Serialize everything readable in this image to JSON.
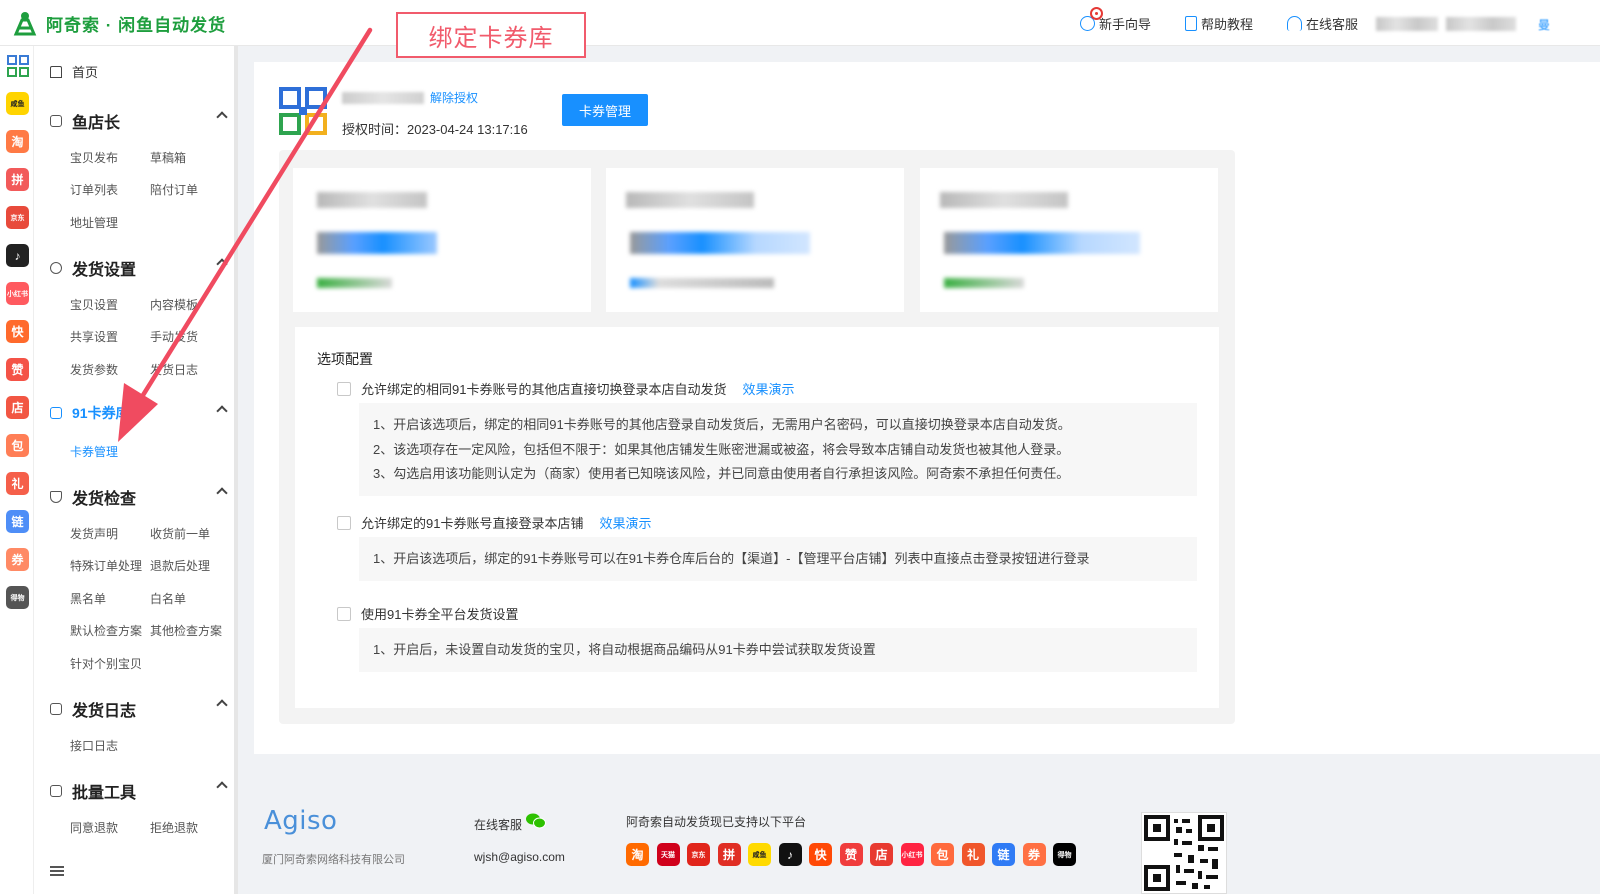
{
  "app": {
    "title": "阿奇索 · 闲鱼自动发货",
    "brand_color": "#1e9e3e",
    "accent": "#1890ff"
  },
  "header": {
    "links": [
      {
        "label": "新手向导",
        "icon": "guide-icon"
      },
      {
        "label": "帮助教程",
        "icon": "doc-icon"
      },
      {
        "label": "在线客服",
        "icon": "headset-icon"
      }
    ],
    "user_trailing": "曼"
  },
  "annotation": {
    "callout_text": "绑定卡券库",
    "color": "#f15b6c"
  },
  "iconbar": [
    {
      "name": "xianyu-app-icon",
      "label": "咸鱼",
      "color": "#ffd400"
    },
    {
      "name": "taobao-app-icon",
      "label": "淘",
      "color": "#ff7a45"
    },
    {
      "name": "pinduoduo-app-icon",
      "label": "拼",
      "color": "#f25a5a"
    },
    {
      "name": "jd-app-icon",
      "label": "京东",
      "color": "#e84a3b"
    },
    {
      "name": "douyin-app-icon",
      "label": "♪",
      "color": "#222222"
    },
    {
      "name": "xiaohongshu-app-icon",
      "label": "小红书",
      "color": "#ff5a5f"
    },
    {
      "name": "kuaishou-app-icon",
      "label": "快",
      "color": "#ff6a2c"
    },
    {
      "name": "like-app-icon",
      "label": "赞",
      "color": "#f45347"
    },
    {
      "name": "store-app-icon",
      "label": "店",
      "color": "#f25643"
    },
    {
      "name": "bag-app-icon",
      "label": "包",
      "color": "#ff7e56"
    },
    {
      "name": "gift-app-icon",
      "label": "礼",
      "color": "#f55f4a"
    },
    {
      "name": "link-app-icon",
      "label": "链",
      "color": "#4e8ef7"
    },
    {
      "name": "ticket-app-icon",
      "label": "券",
      "color": "#ff8a65"
    },
    {
      "name": "dewu-app-icon",
      "label": "得物",
      "color": "#555555"
    }
  ],
  "sidebar": {
    "home": "首页",
    "groups": [
      {
        "label": "鱼店长",
        "items": [
          "宝贝发布",
          "草稿箱",
          "订单列表",
          "陪付订单",
          "地址管理"
        ]
      },
      {
        "label": "发货设置",
        "items": [
          "宝贝设置",
          "内容模板",
          "共享设置",
          "手动发货",
          "发货参数",
          "发货日志"
        ]
      },
      {
        "label": "91卡券库",
        "items": [
          "卡券管理"
        ]
      },
      {
        "label": "发货检查",
        "items": [
          "发货声明",
          "收货前一单",
          "特殊订单处理",
          "退款后处理",
          "黑名单",
          "白名单",
          "默认检查方案",
          "其他检查方案",
          "针对个别宝贝"
        ]
      },
      {
        "label": "发货日志",
        "items": [
          "接口日志"
        ]
      },
      {
        "label": "批量工具",
        "items": [
          "同意退款",
          "拒绝退款"
        ]
      }
    ]
  },
  "main": {
    "unauthorize_link": "解除授权",
    "auth_time_label": "授权时间：",
    "auth_time_value": "2023-04-24 13:17:16",
    "card_manage_button": "卡券管理",
    "options": {
      "title": "选项配置",
      "items": [
        {
          "label": "允许绑定的相同91卡券账号的其他店直接切换登录本店自动发货",
          "demo": "效果演示",
          "notes": [
            "1、开启该选项后，绑定的相同91卡券账号的其他店登录自动发货后，无需用户名密码，可以直接切换登录本店自动发货。",
            "2、该选项存在一定风险，包括但不限于：如果其他店铺发生账密泄漏或被盗，将会导致本店铺自动发货也被其他人登录。",
            "3、勾选启用该功能则认定为（商家）使用者已知晓该风险，并已同意由使用者自行承担该风险。阿奇索不承担任何责任。"
          ]
        },
        {
          "label": "允许绑定的91卡券账号直接登录本店铺",
          "demo": "效果演示",
          "notes": [
            "1、开启该选项后，绑定的91卡券账号可以在91卡券仓库后台的【渠道】-【管理平台店铺】列表中直接点击登录按钮进行登录"
          ]
        },
        {
          "label": "使用91卡券全平台发货设置",
          "demo": "",
          "notes": [
            "1、开启后，未设置自动发货的宝贝，将自动根据商品编码从91卡券中尝试获取发货设置"
          ]
        }
      ]
    }
  },
  "footer": {
    "brand": "Agiso",
    "company": "厦门阿奇索网络科技有限公司",
    "service_label": "在线客服",
    "email": "wjsh@agiso.com",
    "support_text": "阿奇索自动发货现已支持以下平台",
    "platforms": [
      {
        "label": "淘",
        "color": "#ff6a00"
      },
      {
        "label": "天猫",
        "color": "#d0011b"
      },
      {
        "label": "京东",
        "color": "#e1251b"
      },
      {
        "label": "拼",
        "color": "#e02e24"
      },
      {
        "label": "咸鱼",
        "color": "#ffda00"
      },
      {
        "label": "♪",
        "color": "#111111"
      },
      {
        "label": "快",
        "color": "#ff4906"
      },
      {
        "label": "赞",
        "color": "#f03c3c"
      },
      {
        "label": "店",
        "color": "#e83a30"
      },
      {
        "label": "小红书",
        "color": "#ff2442"
      },
      {
        "label": "包",
        "color": "#ff6a3d"
      },
      {
        "label": "礼",
        "color": "#f0562b"
      },
      {
        "label": "链",
        "color": "#2f7bf5"
      },
      {
        "label": "券",
        "color": "#ff7043"
      },
      {
        "label": "得物",
        "color": "#000000"
      }
    ]
  }
}
